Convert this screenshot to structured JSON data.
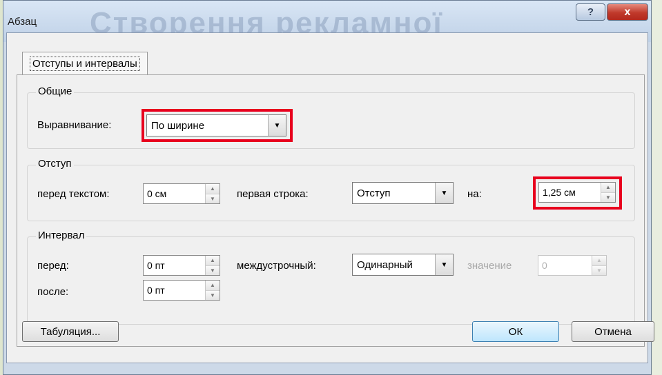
{
  "window": {
    "title": "Абзац",
    "background_ghost_text": "Створення рекламної",
    "help_glyph": "?",
    "close_glyph": "x"
  },
  "tabs": [
    {
      "label": "Отступы и интервалы",
      "selected": true
    }
  ],
  "general": {
    "title": "Общие",
    "alignment_label": "Выравнивание:",
    "alignment_value": "По ширине"
  },
  "indent": {
    "title": "Отступ",
    "before_label": "перед текстом:",
    "before_value": "0 см",
    "first_line_label": "первая строка:",
    "first_line_value": "Отступ",
    "by_label": "на:",
    "by_value": "1,25 см"
  },
  "spacing": {
    "title": "Интервал",
    "before_label": "перед:",
    "before_value": "0 пт",
    "after_label": "после:",
    "after_value": "0 пт",
    "line_label": "междустрочный:",
    "line_value": "Одинарный",
    "at_label": "значение",
    "at_value": "0"
  },
  "buttons": {
    "tabs_label": "Табуляция...",
    "ok_label": "ОК",
    "cancel_label": "Отмена"
  },
  "colors": {
    "highlight": "#e8001e",
    "close_button": "#c0392b"
  },
  "icons": {
    "dropdown": "chevron-down-icon",
    "spin_up": "spin-up-icon",
    "spin_down": "spin-down-icon"
  }
}
